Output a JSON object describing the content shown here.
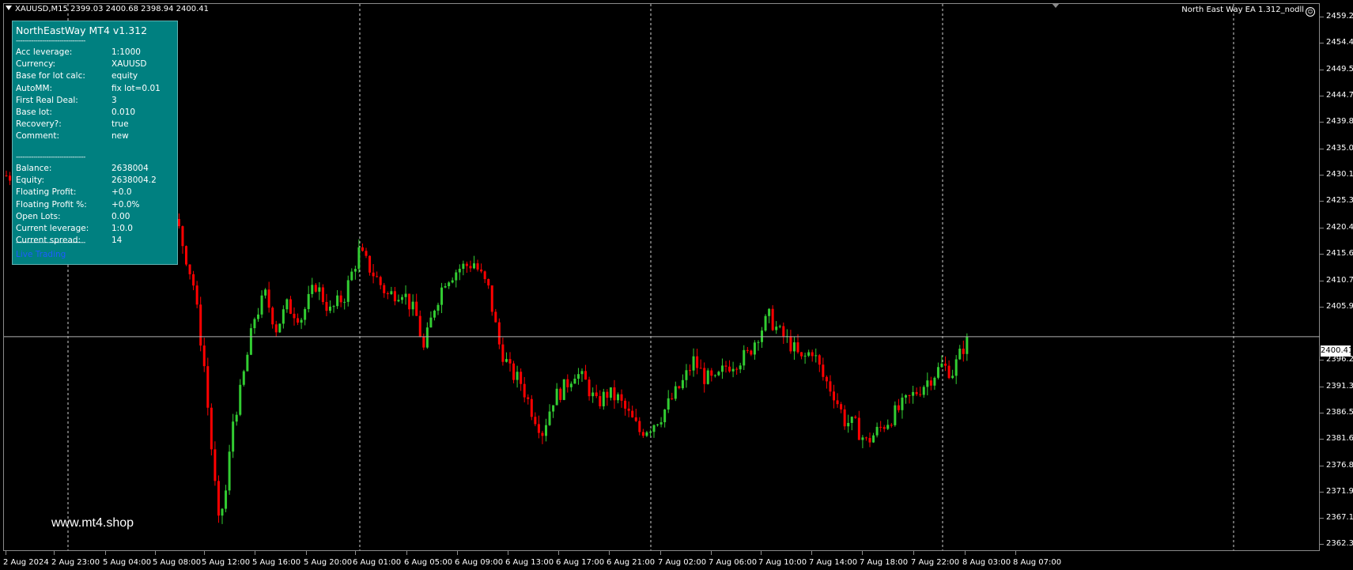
{
  "chart_header": {
    "symbol_info": "XAUUSD,M15  2399.03 2400.68 2398.94 2400.41",
    "ea_label": "North East Way EA 1.312_nodll"
  },
  "info_panel": {
    "title": "NorthEastWay MT4 v1.312",
    "separator": "--------------------------------",
    "settings": [
      {
        "label": "Acc leverage:",
        "value": "1:1000"
      },
      {
        "label": "Currency:",
        "value": "XAUUSD"
      },
      {
        "label": "Base for lot calc:",
        "value": "equity"
      },
      {
        "label": "AutoMM:",
        "value": "fix lot=0.01"
      },
      {
        "label": "First Real Deal:",
        "value": "3"
      },
      {
        "label": "Base lot:",
        "value": "0.010"
      },
      {
        "label": "Recovery?:",
        "value": "true"
      },
      {
        "label": "Comment:",
        "value": "new"
      }
    ],
    "stats": [
      {
        "label": "Balance:",
        "value": "2638004"
      },
      {
        "label": "Equity:",
        "value": "2638004.2"
      },
      {
        "label": "Floating Profit:",
        "value": "+0.0"
      },
      {
        "label": "Floating Profit %:",
        "value": "+0.0%"
      },
      {
        "label": "Open Lots:",
        "value": "0.00"
      },
      {
        "label": "Current leverage:",
        "value": "1:0.0"
      },
      {
        "label": "Current spread:",
        "value": "14"
      }
    ],
    "status": "Live Trading"
  },
  "watermark": "www.mt4.shop",
  "current_price": "2400.41",
  "colors": {
    "bull": "#32cd32",
    "bear": "#ff0000",
    "panel": "#008080",
    "status": "#1e5bff"
  },
  "chart_data": {
    "type": "candlestick",
    "symbol": "XAUUSD",
    "timeframe": "M15",
    "ylim": [
      2361.2,
      2461.5
    ],
    "y_ticks": [
      "2459.20",
      "2454.40",
      "2449.50",
      "2444.70",
      "2439.80",
      "2435.00",
      "2430.10",
      "2425.30",
      "2420.40",
      "2415.60",
      "2410.70",
      "2405.90",
      "2396.20",
      "2391.30",
      "2386.50",
      "2381.60",
      "2376.80",
      "2371.90",
      "2367.10",
      "2362.30"
    ],
    "x_ticks": [
      "2 Aug 2024",
      "2 Aug 23:00",
      "5 Aug 04:00",
      "5 Aug 08:00",
      "5 Aug 12:00",
      "5 Aug 16:00",
      "5 Aug 20:00",
      "6 Aug 01:00",
      "6 Aug 05:00",
      "6 Aug 09:00",
      "6 Aug 13:00",
      "6 Aug 17:00",
      "6 Aug 21:00",
      "7 Aug 02:00",
      "7 Aug 06:00",
      "7 Aug 10:00",
      "7 Aug 14:00",
      "7 Aug 18:00",
      "7 Aug 22:00",
      "8 Aug 03:00",
      "8 Aug 07:00"
    ],
    "current_price": 2400.41,
    "close_path": [
      [
        0,
        2430
      ],
      [
        8,
        2429
      ],
      [
        14,
        2418
      ],
      [
        22,
        2424
      ],
      [
        28,
        2430
      ],
      [
        33,
        2442
      ],
      [
        36,
        2434
      ],
      [
        40,
        2428
      ],
      [
        44,
        2425
      ],
      [
        48,
        2420
      ],
      [
        52,
        2410
      ],
      [
        55,
        2395
      ],
      [
        57,
        2380
      ],
      [
        59,
        2366
      ],
      [
        61,
        2372
      ],
      [
        63,
        2385
      ],
      [
        65,
        2390
      ],
      [
        67,
        2397
      ],
      [
        69,
        2404
      ],
      [
        72,
        2408
      ],
      [
        75,
        2402
      ],
      [
        78,
        2406
      ],
      [
        82,
        2404
      ],
      [
        86,
        2410
      ],
      [
        90,
        2405
      ],
      [
        94,
        2408
      ],
      [
        98,
        2416
      ],
      [
        102,
        2412
      ],
      [
        106,
        2408
      ],
      [
        110,
        2409
      ],
      [
        114,
        2404
      ],
      [
        116,
        2398
      ],
      [
        119,
        2406
      ],
      [
        122,
        2411
      ],
      [
        126,
        2413
      ],
      [
        130,
        2414
      ],
      [
        134,
        2409
      ],
      [
        137,
        2399
      ],
      [
        140,
        2394
      ],
      [
        143,
        2392
      ],
      [
        146,
        2387
      ],
      [
        149,
        2383
      ],
      [
        152,
        2389
      ],
      [
        155,
        2391
      ],
      [
        158,
        2394
      ],
      [
        161,
        2392
      ],
      [
        164,
        2388
      ],
      [
        167,
        2390
      ],
      [
        170,
        2389
      ],
      [
        173,
        2386
      ],
      [
        176,
        2383
      ],
      [
        179,
        2384
      ],
      [
        182,
        2386
      ],
      [
        185,
        2389
      ],
      [
        188,
        2392
      ],
      [
        191,
        2396
      ],
      [
        194,
        2393
      ],
      [
        197,
        2392
      ],
      [
        200,
        2395
      ],
      [
        203,
        2396
      ],
      [
        206,
        2397
      ],
      [
        209,
        2401
      ],
      [
        212,
        2404
      ],
      [
        215,
        2401
      ],
      [
        218,
        2399
      ],
      [
        221,
        2396
      ],
      [
        224,
        2398
      ],
      [
        227,
        2393
      ],
      [
        230,
        2390
      ],
      [
        233,
        2385
      ],
      [
        236,
        2384
      ],
      [
        239,
        2381
      ],
      [
        242,
        2383
      ],
      [
        245,
        2385
      ],
      [
        248,
        2387
      ],
      [
        251,
        2389
      ],
      [
        254,
        2391
      ],
      [
        257,
        2393
      ],
      [
        260,
        2395
      ],
      [
        263,
        2394
      ],
      [
        265,
        2397
      ],
      [
        267,
        2400
      ]
    ]
  }
}
